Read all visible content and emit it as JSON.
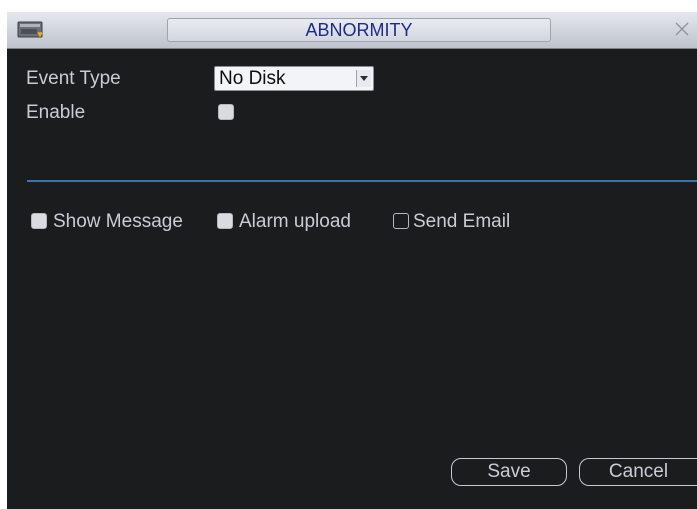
{
  "window": {
    "title": "ABNORMITY",
    "menu_icon": "menu-icon",
    "close_icon": "close-icon"
  },
  "form": {
    "event_type_label": "Event Type",
    "event_type_value": "No Disk",
    "enable_label": "Enable",
    "enable_checked": true
  },
  "actions": {
    "show_message_label": "Show Message",
    "show_message_checked": true,
    "alarm_upload_label": "Alarm upload",
    "alarm_upload_checked": true,
    "send_email_label": "Send Email",
    "send_email_checked": false
  },
  "buttons": {
    "save": "Save",
    "cancel": "Cancel"
  },
  "colors": {
    "background": "#1a1c1e",
    "title_text": "#1f2a8a",
    "divider": "#3f72ac",
    "label_text": "#c9ccd6"
  }
}
